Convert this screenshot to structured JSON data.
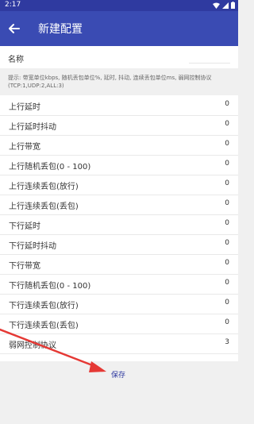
{
  "status": {
    "time": "2:17"
  },
  "appbar": {
    "title": "新建配置"
  },
  "name": {
    "label": "名称",
    "value": ""
  },
  "hint": {
    "text": "提示: 带宽单位kbps, 随机丢包单位%, 延时, 抖动, 连续丢包单位ms, 弱网控制协议(TCP:1,UDP:2,ALL:3)"
  },
  "rows": [
    {
      "label": "上行延时",
      "value": "0"
    },
    {
      "label": "上行延时抖动",
      "value": "0"
    },
    {
      "label": "上行带宽",
      "value": "0"
    },
    {
      "label": "上行随机丢包(0 - 100)",
      "value": "0"
    },
    {
      "label": "上行连续丢包(放行)",
      "value": "0"
    },
    {
      "label": "上行连续丢包(丢包)",
      "value": "0"
    },
    {
      "label": "下行延时",
      "value": "0"
    },
    {
      "label": "下行延时抖动",
      "value": "0"
    },
    {
      "label": "下行带宽",
      "value": "0"
    },
    {
      "label": "下行随机丢包(0 - 100)",
      "value": "0"
    },
    {
      "label": "下行连续丢包(放行)",
      "value": "0"
    },
    {
      "label": "下行连续丢包(丢包)",
      "value": "0"
    },
    {
      "label": "弱网控制协议",
      "value": "3"
    }
  ],
  "actions": {
    "save_label": "保存"
  },
  "icons": {
    "back": "arrow-back-icon",
    "wifi": "wifi-icon",
    "signal": "signal-icon",
    "battery": "battery-icon"
  },
  "colors": {
    "primary": "#3a4bb3",
    "primary_dark": "#2f3aa0",
    "annotation": "#e53935"
  }
}
